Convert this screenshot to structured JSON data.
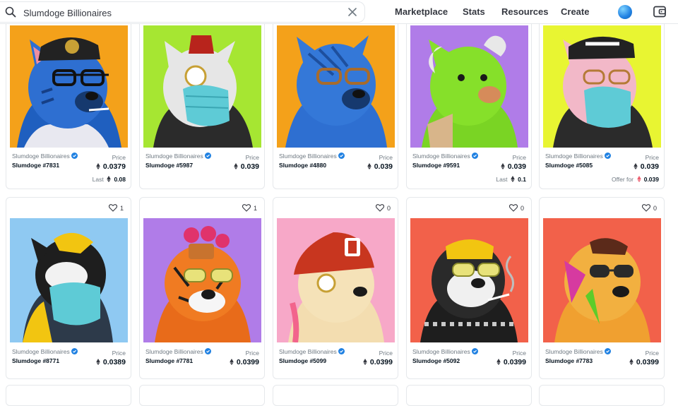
{
  "header": {
    "search_value": "Slumdoge Billionaires",
    "search_icon": "search-icon",
    "clear_icon": "close-icon",
    "nav": [
      {
        "label": "Marketplace"
      },
      {
        "label": "Stats"
      },
      {
        "label": "Resources"
      },
      {
        "label": "Create"
      }
    ],
    "avatar_color": "#2081e2",
    "wallet_icon": "wallet-icon"
  },
  "price_label": "Price",
  "cards": [
    {
      "collection": "Slumdoge Billionaires",
      "name": "Slumdoge #7831",
      "price": "0.0379",
      "sub_label": "Last",
      "sub_value": "0.08",
      "sub_icon": "eth",
      "bg": "#f4a11a"
    },
    {
      "collection": "Slumdoge Billionaires",
      "name": "Slumdoge #5987",
      "price": "0.039",
      "bg": "#a6e632"
    },
    {
      "collection": "Slumdoge Billionaires",
      "name": "Slumdoge #4880",
      "price": "0.039",
      "bg": "#f4a11a"
    },
    {
      "collection": "Slumdoge Billionaires",
      "name": "Slumdoge #9591",
      "price": "0.039",
      "sub_label": "Last",
      "sub_value": "0.1",
      "sub_icon": "eth",
      "bg": "#b07ce8"
    },
    {
      "collection": "Slumdoge Billionaires",
      "name": "Slumdoge #5085",
      "price": "0.039",
      "sub_label": "Offer for",
      "sub_value": "0.039",
      "sub_icon": "weth",
      "bg": "#e8f532"
    },
    {
      "collection": "Slumdoge Billionaires",
      "name": "Slumdoge #8771",
      "price": "0.0389",
      "likes": "1",
      "bg": "#8fc9f2"
    },
    {
      "collection": "Slumdoge Billionaires",
      "name": "Slumdoge #7781",
      "price": "0.0399",
      "likes": "1",
      "bg": "#b07ce8"
    },
    {
      "collection": "Slumdoge Billionaires",
      "name": "Slumdoge #5099",
      "price": "0.0399",
      "likes": "0",
      "bg": "#f7a8c8"
    },
    {
      "collection": "Slumdoge Billionaires",
      "name": "Slumdoge #5092",
      "price": "0.0399",
      "likes": "0",
      "bg": "#f2614a"
    },
    {
      "collection": "Slumdoge Billionaires",
      "name": "Slumdoge #7783",
      "price": "0.0399",
      "likes": "0",
      "bg": "#f2614a"
    }
  ],
  "colors": {
    "verified": "#2081e2",
    "eth": "#353840",
    "weth": "#ec5e6f",
    "border": "#e5e8eb",
    "muted_text": "#707a83"
  }
}
